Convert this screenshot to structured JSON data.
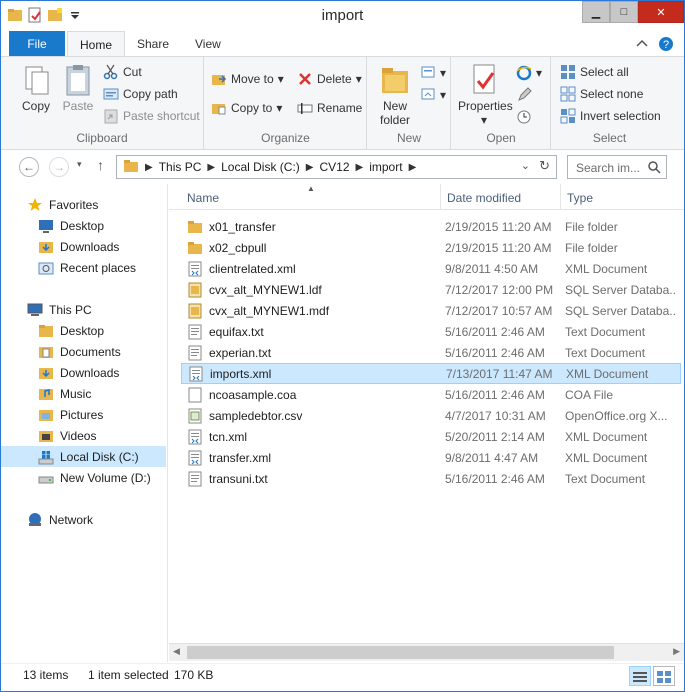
{
  "window": {
    "title": "import"
  },
  "ribbon_tabs": {
    "file": "File",
    "home": "Home",
    "share": "Share",
    "view": "View"
  },
  "clipboard": {
    "copy": "Copy",
    "paste": "Paste",
    "cut": "Cut",
    "copy_path": "Copy path",
    "paste_shortcut": "Paste shortcut",
    "label": "Clipboard"
  },
  "organize": {
    "move_to": "Move to",
    "copy_to": "Copy to",
    "delete": "Delete",
    "rename": "Rename",
    "label": "Organize"
  },
  "new": {
    "new_folder_line1": "New",
    "new_folder_line2": "folder",
    "label": "New"
  },
  "open": {
    "properties": "Properties",
    "label": "Open"
  },
  "select": {
    "select_all": "Select all",
    "select_none": "Select none",
    "invert_selection": "Invert selection",
    "label": "Select"
  },
  "address": {
    "crumbs": [
      "This PC",
      "Local Disk (C:)",
      "CV12",
      "import"
    ],
    "search_placeholder": "Search im..."
  },
  "nav": {
    "favorites": "Favorites",
    "fav_items": [
      "Desktop",
      "Downloads",
      "Recent places"
    ],
    "this_pc": "This PC",
    "pc_items": [
      "Desktop",
      "Documents",
      "Downloads",
      "Music",
      "Pictures",
      "Videos",
      "Local Disk (C:)",
      "New Volume (D:)"
    ],
    "network": "Network"
  },
  "columns": {
    "name": "Name",
    "date": "Date modified",
    "type": "Type"
  },
  "files": [
    {
      "name": "x01_transfer",
      "date": "2/19/2015 11:20 AM",
      "type": "File folder",
      "icon": "folder-icon"
    },
    {
      "name": "x02_cbpull",
      "date": "2/19/2015 11:20 AM",
      "type": "File folder",
      "icon": "folder-icon"
    },
    {
      "name": "clientrelated.xml",
      "date": "9/8/2011 4:50 AM",
      "type": "XML Document",
      "icon": "xml-file-icon"
    },
    {
      "name": "cvx_alt_MYNEW1.ldf",
      "date": "7/12/2017 12:00 PM",
      "type": "SQL Server Databa...",
      "icon": "sql-file-icon"
    },
    {
      "name": "cvx_alt_MYNEW1.mdf",
      "date": "7/12/2017 10:57 AM",
      "type": "SQL Server Databa...",
      "icon": "sql-file-icon"
    },
    {
      "name": "equifax.txt",
      "date": "5/16/2011 2:46 AM",
      "type": "Text Document",
      "icon": "text-file-icon"
    },
    {
      "name": "experian.txt",
      "date": "5/16/2011 2:46 AM",
      "type": "Text Document",
      "icon": "text-file-icon"
    },
    {
      "name": "imports.xml",
      "date": "7/13/2017 11:47 AM",
      "type": "XML Document",
      "icon": "xml-file-icon"
    },
    {
      "name": "ncoasample.coa",
      "date": "5/16/2011 2:46 AM",
      "type": "COA File",
      "icon": "generic-file-icon"
    },
    {
      "name": "sampledebtor.csv",
      "date": "4/7/2017 10:31 AM",
      "type": "OpenOffice.org X...",
      "icon": "csv-file-icon"
    },
    {
      "name": "tcn.xml",
      "date": "5/20/2011 2:14 AM",
      "type": "XML Document",
      "icon": "xml-file-icon"
    },
    {
      "name": "transfer.xml",
      "date": "9/8/2011 4:47 AM",
      "type": "XML Document",
      "icon": "xml-file-icon"
    },
    {
      "name": "transuni.txt",
      "date": "5/16/2011 2:46 AM",
      "type": "Text Document",
      "icon": "text-file-icon"
    }
  ],
  "selected_index": 7,
  "status": {
    "count": "13 items",
    "selected": "1 item selected",
    "size": "170 KB"
  },
  "colors": {
    "accent": "#1979ca",
    "selection": "#cce8ff",
    "close": "#c42b1c",
    "folder": "#e8b64a"
  }
}
